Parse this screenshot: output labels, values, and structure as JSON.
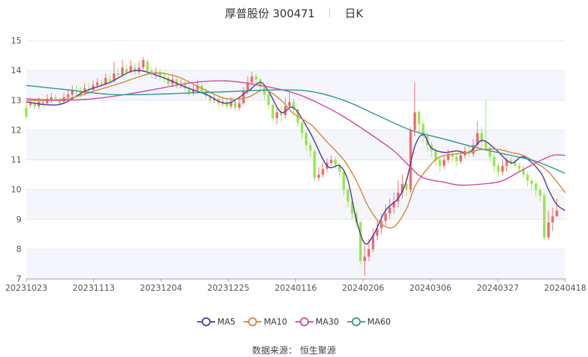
{
  "header": {
    "stock": "厚普股份 300471",
    "period": "日K"
  },
  "source": {
    "label": "数据来源：",
    "provider": "恒生聚源"
  },
  "colors": {
    "up": "#f06a6a",
    "down": "#93e84e",
    "ma5": "#5b3fa5",
    "ma10": "#d98c3c",
    "ma30": "#d14fa0",
    "ma60": "#3a9a9a",
    "grid": "#e3e7f2",
    "band": "#f4f6fb"
  },
  "chart_data": {
    "type": "candlestick",
    "x_ticks": [
      "20231023",
      "20231113",
      "20231204",
      "20231225",
      "20240116",
      "20240206",
      "20240306",
      "20240327",
      "20240418"
    ],
    "y_ticks": [
      7,
      8,
      9,
      10,
      11,
      12,
      13,
      14,
      15
    ],
    "ylim": [
      7,
      15
    ],
    "grid": true,
    "legend_position": "bottom",
    "series": [
      {
        "name": "MA5",
        "key": "ma5",
        "points": [
          [
            0,
            12.95
          ],
          [
            5,
            12.85
          ],
          [
            9,
            12.9
          ],
          [
            14,
            13.3
          ],
          [
            20,
            13.6
          ],
          [
            26,
            14.0
          ],
          [
            32,
            13.8
          ],
          [
            38,
            13.45
          ],
          [
            43,
            13.2
          ],
          [
            48,
            12.9
          ],
          [
            53,
            13.3
          ],
          [
            56,
            13.6
          ],
          [
            58,
            13.3
          ],
          [
            61,
            12.6
          ],
          [
            64,
            12.75
          ],
          [
            68,
            11.9
          ],
          [
            72,
            10.8
          ],
          [
            75,
            10.8
          ],
          [
            77,
            10.3
          ],
          [
            79,
            9.0
          ],
          [
            81,
            8.2
          ],
          [
            83,
            8.45
          ],
          [
            86,
            9.3
          ],
          [
            89,
            9.7
          ],
          [
            91,
            10.3
          ],
          [
            93,
            11.45
          ],
          [
            95,
            11.85
          ],
          [
            97,
            11.4
          ],
          [
            100,
            11.25
          ],
          [
            103,
            11.3
          ],
          [
            106,
            11.25
          ],
          [
            109,
            11.65
          ],
          [
            112,
            11.4
          ],
          [
            116,
            10.9
          ],
          [
            119,
            11.1
          ],
          [
            123,
            10.6
          ],
          [
            125,
            10.0
          ],
          [
            127,
            9.5
          ],
          [
            129,
            9.3
          ]
        ]
      },
      {
        "name": "MA10",
        "key": "ma10",
        "points": [
          [
            0,
            13.0
          ],
          [
            5,
            13.0
          ],
          [
            10,
            13.05
          ],
          [
            16,
            13.3
          ],
          [
            22,
            13.55
          ],
          [
            30,
            13.9
          ],
          [
            36,
            13.8
          ],
          [
            42,
            13.4
          ],
          [
            48,
            13.05
          ],
          [
            53,
            13.1
          ],
          [
            57,
            13.35
          ],
          [
            61,
            13.0
          ],
          [
            64,
            12.55
          ],
          [
            68,
            12.2
          ],
          [
            72,
            11.6
          ],
          [
            76,
            11.0
          ],
          [
            79,
            10.3
          ],
          [
            82,
            9.4
          ],
          [
            85,
            8.85
          ],
          [
            88,
            8.75
          ],
          [
            91,
            9.35
          ],
          [
            93,
            10.1
          ],
          [
            96,
            10.7
          ],
          [
            99,
            11.1
          ],
          [
            103,
            11.2
          ],
          [
            106,
            11.25
          ],
          [
            109,
            11.35
          ],
          [
            113,
            11.35
          ],
          [
            116,
            11.25
          ],
          [
            119,
            11.15
          ],
          [
            122,
            10.9
          ],
          [
            125,
            10.6
          ],
          [
            129,
            9.9
          ]
        ]
      },
      {
        "name": "MA30",
        "key": "ma30",
        "points": [
          [
            0,
            13.05
          ],
          [
            8,
            13.0
          ],
          [
            16,
            13.05
          ],
          [
            24,
            13.2
          ],
          [
            32,
            13.4
          ],
          [
            40,
            13.6
          ],
          [
            48,
            13.65
          ],
          [
            56,
            13.5
          ],
          [
            64,
            13.25
          ],
          [
            70,
            12.9
          ],
          [
            76,
            12.45
          ],
          [
            82,
            11.9
          ],
          [
            88,
            11.3
          ],
          [
            92,
            10.75
          ],
          [
            95,
            10.4
          ],
          [
            100,
            10.25
          ],
          [
            104,
            10.15
          ],
          [
            110,
            10.2
          ],
          [
            114,
            10.3
          ],
          [
            118,
            10.6
          ],
          [
            122,
            10.9
          ],
          [
            126,
            11.15
          ],
          [
            129,
            11.15
          ]
        ]
      },
      {
        "name": "MA60",
        "key": "ma60",
        "points": [
          [
            0,
            13.5
          ],
          [
            10,
            13.35
          ],
          [
            20,
            13.2
          ],
          [
            30,
            13.2
          ],
          [
            40,
            13.25
          ],
          [
            50,
            13.3
          ],
          [
            60,
            13.35
          ],
          [
            68,
            13.3
          ],
          [
            76,
            13.0
          ],
          [
            84,
            12.5
          ],
          [
            92,
            12.0
          ],
          [
            100,
            11.7
          ],
          [
            108,
            11.4
          ],
          [
            116,
            11.15
          ],
          [
            122,
            10.95
          ],
          [
            129,
            10.55
          ]
        ]
      }
    ],
    "candles": [
      [
        12.75,
        12.45,
        12.95,
        12.35
      ],
      [
        12.85,
        12.9,
        13.05,
        12.75
      ],
      [
        12.9,
        12.8,
        13.0,
        12.7
      ],
      [
        12.8,
        12.95,
        13.1,
        12.7
      ],
      [
        12.95,
        12.85,
        13.05,
        12.75
      ],
      [
        12.9,
        13.05,
        13.2,
        12.85
      ],
      [
        13.0,
        13.1,
        13.25,
        12.9
      ],
      [
        13.1,
        13.05,
        13.2,
        12.95
      ],
      [
        13.0,
        12.9,
        13.1,
        12.85
      ],
      [
        12.95,
        13.1,
        13.25,
        12.9
      ],
      [
        13.1,
        13.2,
        13.35,
        13.0
      ],
      [
        13.2,
        13.35,
        13.5,
        13.1
      ],
      [
        13.35,
        13.3,
        13.5,
        13.2
      ],
      [
        13.3,
        13.2,
        13.45,
        13.1
      ],
      [
        13.25,
        13.4,
        13.55,
        13.15
      ],
      [
        13.4,
        13.35,
        13.55,
        13.25
      ],
      [
        13.35,
        13.5,
        13.65,
        13.3
      ],
      [
        13.5,
        13.6,
        13.75,
        13.4
      ],
      [
        13.6,
        13.55,
        13.7,
        13.45
      ],
      [
        13.55,
        13.75,
        13.9,
        13.5
      ],
      [
        13.7,
        13.65,
        13.85,
        13.55
      ],
      [
        13.65,
        13.9,
        14.3,
        13.6
      ],
      [
        13.9,
        13.85,
        14.1,
        13.7
      ],
      [
        13.85,
        14.1,
        14.35,
        13.8
      ],
      [
        14.05,
        13.95,
        14.2,
        13.8
      ],
      [
        13.95,
        14.15,
        14.35,
        13.9
      ],
      [
        14.1,
        13.95,
        14.25,
        13.85
      ],
      [
        13.95,
        14.1,
        14.3,
        13.85
      ],
      [
        14.1,
        14.35,
        14.45,
        14.0
      ],
      [
        14.3,
        14.0,
        14.4,
        13.85
      ],
      [
        14.0,
        13.9,
        14.1,
        13.75
      ],
      [
        13.9,
        13.95,
        14.1,
        13.7
      ],
      [
        13.95,
        13.8,
        14.05,
        13.65
      ],
      [
        13.8,
        13.75,
        13.95,
        13.6
      ],
      [
        13.75,
        13.55,
        13.85,
        13.45
      ],
      [
        13.55,
        13.7,
        13.85,
        13.45
      ],
      [
        13.7,
        13.5,
        13.8,
        13.4
      ],
      [
        13.5,
        13.55,
        13.7,
        13.4
      ],
      [
        13.55,
        13.4,
        13.65,
        13.3
      ],
      [
        13.4,
        13.25,
        13.5,
        13.15
      ],
      [
        13.25,
        13.35,
        13.5,
        13.15
      ],
      [
        13.35,
        13.5,
        13.7,
        13.25
      ],
      [
        13.5,
        13.3,
        13.6,
        13.2
      ],
      [
        13.3,
        13.15,
        13.4,
        13.05
      ],
      [
        13.15,
        13.0,
        13.25,
        12.9
      ],
      [
        13.0,
        13.05,
        13.2,
        12.9
      ],
      [
        13.05,
        12.9,
        13.15,
        12.8
      ],
      [
        12.9,
        12.95,
        13.1,
        12.8
      ],
      [
        12.95,
        12.8,
        13.05,
        12.7
      ],
      [
        12.8,
        12.95,
        13.1,
        12.7
      ],
      [
        12.95,
        12.75,
        13.05,
        12.65
      ],
      [
        12.75,
        12.9,
        13.05,
        12.65
      ],
      [
        12.9,
        13.3,
        13.45,
        12.85
      ],
      [
        13.3,
        13.6,
        13.8,
        13.2
      ],
      [
        13.6,
        13.8,
        13.95,
        13.5
      ],
      [
        13.8,
        13.7,
        13.9,
        13.5
      ],
      [
        13.7,
        13.45,
        13.75,
        13.3
      ],
      [
        13.45,
        13.2,
        13.5,
        13.0
      ],
      [
        13.2,
        12.85,
        13.3,
        12.7
      ],
      [
        12.85,
        12.4,
        12.9,
        12.3
      ],
      [
        12.4,
        12.6,
        12.75,
        12.2
      ],
      [
        12.6,
        12.5,
        12.8,
        12.3
      ],
      [
        12.5,
        12.8,
        13.1,
        12.4
      ],
      [
        12.8,
        12.95,
        13.3,
        12.7
      ],
      [
        12.95,
        12.7,
        13.05,
        12.5
      ],
      [
        12.7,
        12.25,
        12.75,
        12.1
      ],
      [
        12.25,
        11.9,
        12.3,
        11.7
      ],
      [
        11.9,
        11.5,
        11.95,
        11.3
      ],
      [
        11.5,
        11.3,
        11.6,
        11.1
      ],
      [
        11.3,
        10.4,
        11.35,
        10.3
      ],
      [
        10.4,
        10.5,
        10.75,
        10.3
      ],
      [
        10.5,
        10.7,
        10.9,
        10.4
      ],
      [
        10.7,
        10.9,
        11.05,
        10.6
      ],
      [
        10.9,
        11.0,
        11.15,
        10.8
      ],
      [
        11.0,
        10.85,
        11.1,
        10.7
      ],
      [
        10.85,
        10.6,
        10.9,
        10.4
      ],
      [
        10.6,
        10.0,
        10.65,
        9.8
      ],
      [
        10.0,
        9.6,
        10.05,
        9.4
      ],
      [
        9.6,
        9.2,
        9.65,
        9.0
      ],
      [
        9.2,
        8.9,
        9.3,
        8.7
      ],
      [
        8.9,
        7.6,
        8.95,
        7.5
      ],
      [
        7.6,
        7.75,
        8.1,
        7.1
      ],
      [
        7.75,
        8.0,
        8.35,
        7.6
      ],
      [
        8.0,
        8.45,
        8.7,
        7.9
      ],
      [
        8.45,
        8.7,
        9.0,
        8.3
      ],
      [
        8.7,
        8.95,
        9.2,
        8.5
      ],
      [
        8.95,
        9.2,
        9.5,
        8.8
      ],
      [
        9.2,
        9.4,
        9.7,
        9.0
      ],
      [
        9.4,
        9.6,
        9.9,
        9.2
      ],
      [
        9.6,
        9.9,
        10.3,
        9.4
      ],
      [
        9.9,
        10.2,
        10.5,
        9.7
      ],
      [
        10.2,
        10.0,
        10.4,
        9.8
      ],
      [
        10.0,
        12.0,
        12.1,
        9.9
      ],
      [
        12.0,
        12.6,
        13.6,
        11.8
      ],
      [
        12.6,
        12.2,
        12.7,
        11.9
      ],
      [
        12.2,
        11.8,
        12.3,
        11.6
      ],
      [
        11.8,
        11.5,
        11.9,
        11.3
      ],
      [
        11.5,
        11.3,
        11.6,
        11.1
      ],
      [
        11.3,
        11.0,
        11.4,
        10.8
      ],
      [
        11.0,
        10.8,
        11.1,
        10.6
      ],
      [
        10.8,
        11.0,
        11.15,
        10.7
      ],
      [
        11.0,
        11.2,
        11.35,
        10.9
      ],
      [
        11.2,
        11.1,
        11.3,
        10.95
      ],
      [
        11.1,
        10.95,
        11.2,
        10.8
      ],
      [
        10.95,
        11.15,
        11.3,
        10.85
      ],
      [
        11.15,
        11.3,
        11.45,
        11.05
      ],
      [
        11.3,
        11.2,
        11.45,
        11.1
      ],
      [
        11.2,
        11.5,
        11.7,
        11.1
      ],
      [
        11.5,
        11.9,
        12.3,
        11.4
      ],
      [
        11.9,
        11.6,
        12.1,
        11.4
      ],
      [
        11.6,
        11.4,
        13.0,
        11.3
      ],
      [
        11.4,
        11.1,
        11.5,
        10.9
      ],
      [
        11.1,
        10.8,
        11.2,
        10.6
      ],
      [
        10.8,
        10.6,
        10.9,
        10.4
      ],
      [
        10.6,
        10.8,
        11.0,
        10.5
      ],
      [
        10.8,
        11.0,
        11.1,
        10.6
      ],
      [
        11.0,
        10.9,
        11.1,
        10.8
      ],
      [
        10.9,
        10.8,
        11.0,
        10.7
      ],
      [
        10.8,
        10.7,
        10.9,
        10.6
      ],
      [
        10.7,
        10.5,
        10.8,
        10.4
      ],
      [
        10.5,
        10.3,
        10.6,
        10.1
      ],
      [
        10.3,
        10.2,
        10.4,
        10.0
      ],
      [
        10.2,
        10.0,
        10.3,
        9.8
      ],
      [
        10.0,
        9.8,
        10.1,
        9.6
      ],
      [
        9.8,
        8.4,
        9.9,
        8.3
      ],
      [
        8.4,
        8.9,
        9.3,
        8.3
      ],
      [
        8.9,
        9.1,
        9.4,
        8.6
      ],
      [
        9.1,
        9.3,
        9.7,
        9.1
      ]
    ]
  }
}
